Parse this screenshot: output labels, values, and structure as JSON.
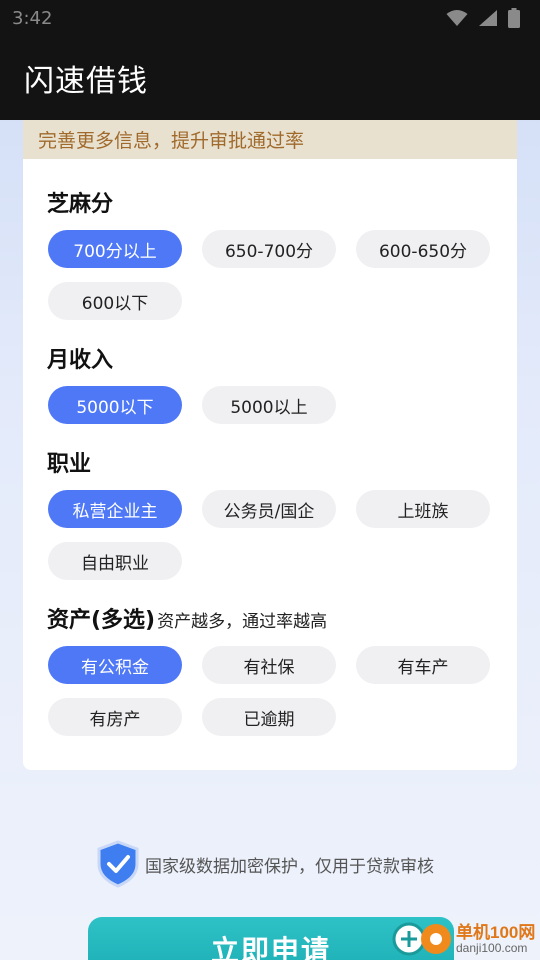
{
  "status_bar": {
    "time": "3:42"
  },
  "app_bar": {
    "title": "闪速借钱"
  },
  "notice": {
    "text": "完善更多信息，提升审批通过率"
  },
  "sections": {
    "sesame": {
      "title": "芝麻分",
      "options": [
        "700分以上",
        "650-700分",
        "600-650分",
        "600以下"
      ],
      "selected": "700分以上"
    },
    "income": {
      "title": "月收入",
      "options": [
        "5000以下",
        "5000以上"
      ],
      "selected": "5000以下"
    },
    "job": {
      "title": "职业",
      "options": [
        "私营企业主",
        "公务员/国企",
        "上班族",
        "自由职业"
      ],
      "selected": "私营企业主"
    },
    "assets": {
      "title": "资产(多选)",
      "subtitle": "资产越多，通过率越高",
      "options": [
        "有公积金",
        "有社保",
        "有车产",
        "有房产",
        "已逾期"
      ],
      "selected": "有公积金"
    }
  },
  "security": {
    "text": "国家级数据加密保护，仅用于贷款审核",
    "icon": "shield-check-icon"
  },
  "apply_button": {
    "label": "立即申请"
  },
  "watermark": {
    "title": "单机100网",
    "url": "danji100.com"
  },
  "colors": {
    "accent": "#4f78f7",
    "button": "#1fb3b8",
    "notice_bg": "#e9e1cf",
    "notice_text": "#a06a2c"
  }
}
